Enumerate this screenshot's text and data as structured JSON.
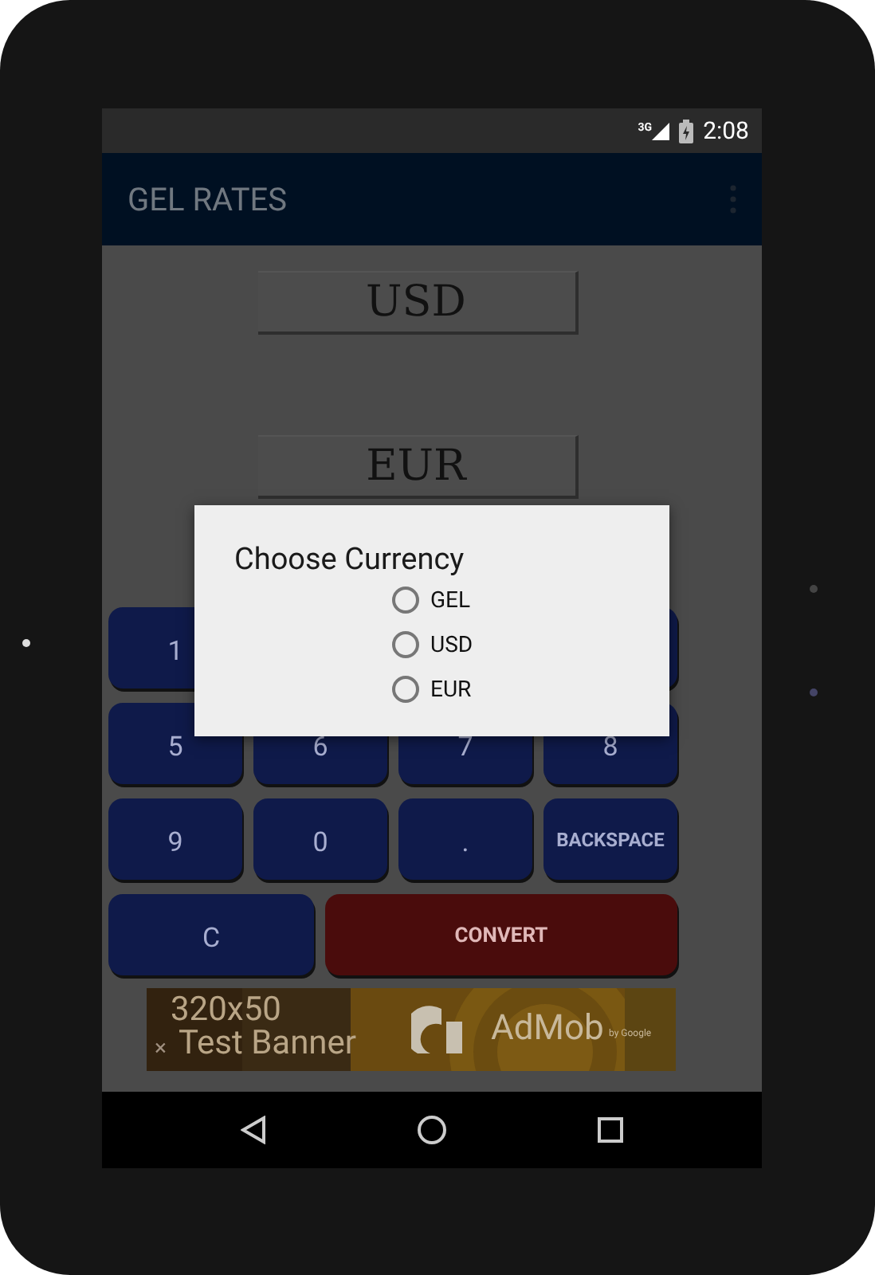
{
  "status_bar": {
    "network": "3G",
    "time": "2:08"
  },
  "app_bar": {
    "title": "GEL RATES"
  },
  "currency_fields": [
    {
      "value": "USD"
    },
    {
      "value": "EUR"
    }
  ],
  "keypad": {
    "rows": [
      [
        "1"
      ],
      [
        "5",
        "6",
        "7",
        "8"
      ],
      [
        "9",
        "0",
        ".",
        "BACKSPACE"
      ]
    ],
    "actions": [
      {
        "label": "C",
        "kind": "clear"
      },
      {
        "label": "CONVERT",
        "kind": "convert"
      }
    ]
  },
  "ad_banner": {
    "size": "320x50",
    "label": "Test Banner",
    "close": "×",
    "brand": "AdMob",
    "byline": "by Google"
  },
  "dialog": {
    "title": "Choose Currency",
    "options": [
      {
        "label": "GEL",
        "selected": false
      },
      {
        "label": "USD",
        "selected": false
      },
      {
        "label": "EUR",
        "selected": false
      }
    ]
  }
}
